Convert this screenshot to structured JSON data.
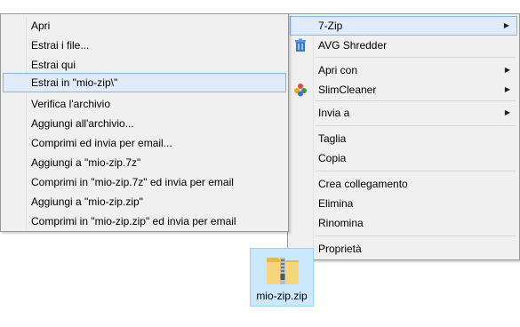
{
  "context_menu": {
    "items": [
      {
        "label": "7-Zip",
        "submenu": true
      },
      {
        "label": "AVG Shredder",
        "icon": "avg-shredder-icon"
      },
      {
        "label": "Apri con",
        "submenu": true
      },
      {
        "label": "SlimCleaner",
        "icon": "slimcleaner-icon",
        "submenu": true
      },
      {
        "label": "Invia a",
        "submenu": true
      },
      {
        "label": "Taglia"
      },
      {
        "label": "Copia"
      },
      {
        "label": "Crea collegamento"
      },
      {
        "label": "Elimina"
      },
      {
        "label": "Rinomina"
      },
      {
        "label": "Proprietà"
      }
    ],
    "arrow": "▶"
  },
  "sevenzip_menu": {
    "items": [
      {
        "label": "Apri"
      },
      {
        "label": "Estrai i file..."
      },
      {
        "label": "Estrai qui"
      },
      {
        "label": "Estrai in \"mio-zip\\\""
      },
      {
        "label": "Verifica l'archivio"
      },
      {
        "label": "Aggiungi all'archivio..."
      },
      {
        "label": "Comprimi ed invia per email..."
      },
      {
        "label": "Aggiungi a \"mio-zip.7z\""
      },
      {
        "label": "Comprimi in \"mio-zip.7z\" ed invia per email"
      },
      {
        "label": "Aggiungi a \"mio-zip.zip\""
      },
      {
        "label": "Comprimi in \"mio-zip.zip\" ed invia per email"
      }
    ]
  },
  "file": {
    "name": "mio-zip.zip",
    "icon": "zip-folder-icon"
  },
  "colors": {
    "menu_bg": "#f0f0f0",
    "highlight_bg": "#e0ecf9",
    "highlight_border": "#8ab4e6",
    "selected_file_bg": "#cce8ff"
  }
}
